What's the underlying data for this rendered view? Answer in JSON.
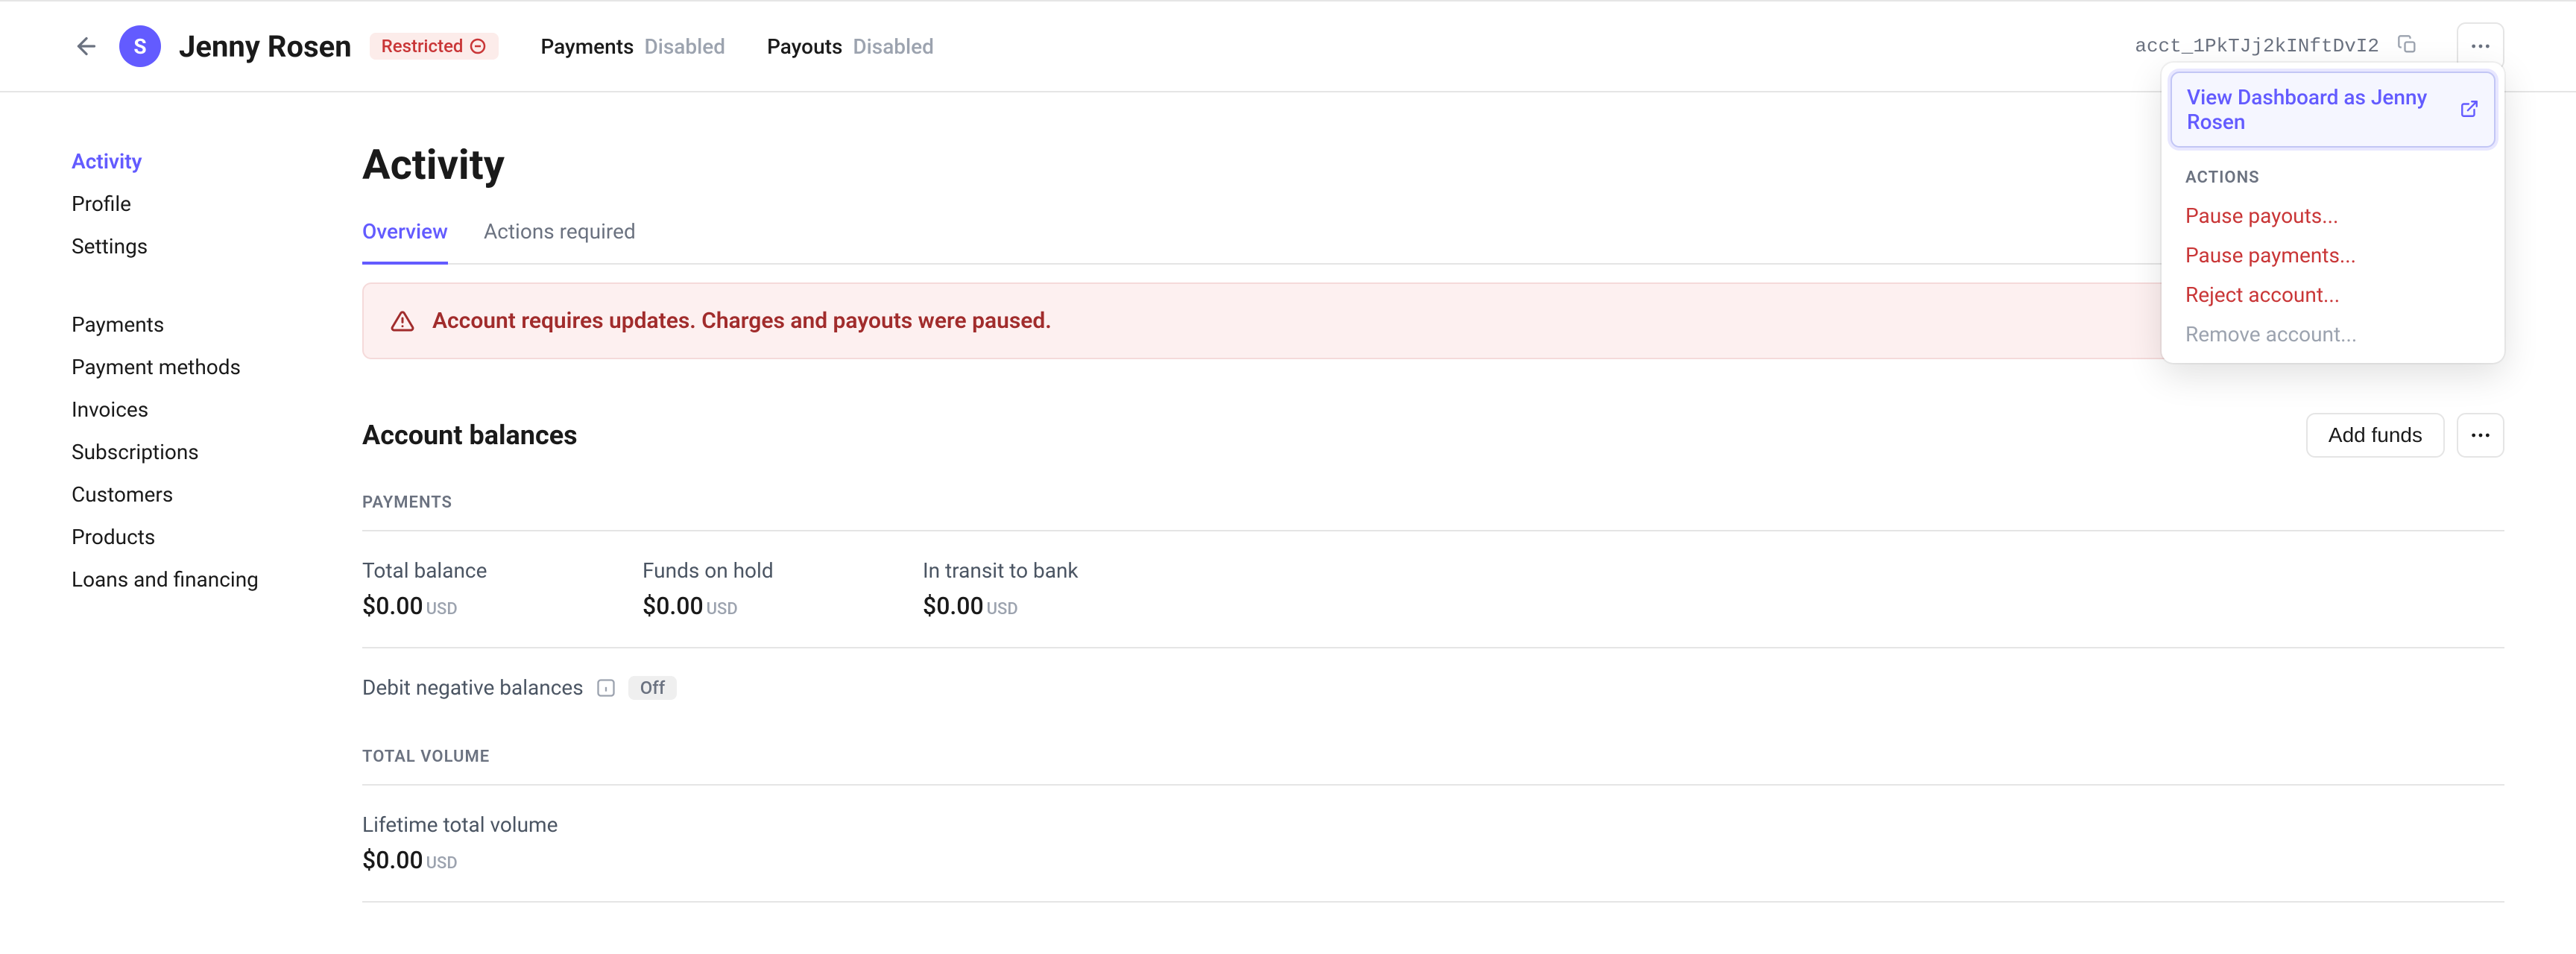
{
  "header": {
    "avatar_letter": "S",
    "account_name": "Jenny Rosen",
    "restricted_label": "Restricted",
    "payments_label": "Payments",
    "payments_status": "Disabled",
    "payouts_label": "Payouts",
    "payouts_status": "Disabled",
    "account_id": "acct_1PkTJj2kINftDvI2"
  },
  "sidebar": {
    "items_primary": [
      {
        "label": "Activity",
        "active": true
      },
      {
        "label": "Profile",
        "active": false
      },
      {
        "label": "Settings",
        "active": false
      }
    ],
    "items_secondary": [
      {
        "label": "Payments"
      },
      {
        "label": "Payment methods"
      },
      {
        "label": "Invoices"
      },
      {
        "label": "Subscriptions"
      },
      {
        "label": "Customers"
      },
      {
        "label": "Products"
      },
      {
        "label": "Loans and financing"
      }
    ]
  },
  "main": {
    "title": "Activity",
    "tabs": [
      {
        "label": "Overview",
        "active": true
      },
      {
        "label": "Actions required",
        "active": false
      }
    ],
    "alert": "Account requires updates. Charges and payouts were paused.",
    "balances": {
      "title": "Account balances",
      "add_funds_label": "Add funds",
      "payments_label": "PAYMENTS",
      "items": [
        {
          "label": "Total balance",
          "value": "$0.00",
          "currency": "USD"
        },
        {
          "label": "Funds on hold",
          "value": "$0.00",
          "currency": "USD"
        },
        {
          "label": "In transit to bank",
          "value": "$0.00",
          "currency": "USD"
        }
      ],
      "debit_label": "Debit negative balances",
      "debit_status": "Off",
      "total_volume_label": "TOTAL VOLUME",
      "lifetime_label": "Lifetime total volume",
      "lifetime_value": "$0.00",
      "lifetime_currency": "USD"
    }
  },
  "dropdown": {
    "primary": "View Dashboard as Jenny Rosen",
    "section_label": "ACTIONS",
    "items": [
      {
        "label": "Pause payouts...",
        "style": "danger"
      },
      {
        "label": "Pause payments...",
        "style": "danger"
      },
      {
        "label": "Reject account...",
        "style": "danger"
      },
      {
        "label": "Remove account...",
        "style": "muted"
      }
    ]
  }
}
